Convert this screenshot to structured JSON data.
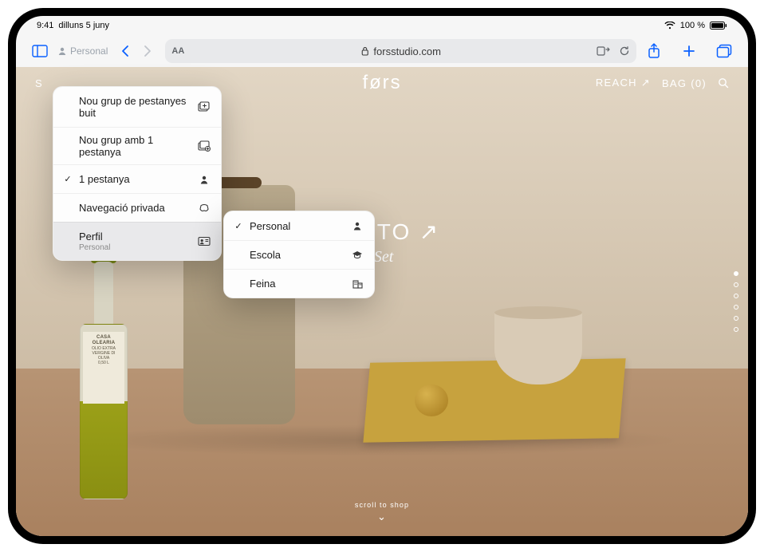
{
  "status": {
    "time": "9:41",
    "date": "dilluns 5 juny",
    "battery": "100 %"
  },
  "toolbar": {
    "profile_label": "Personal",
    "address": "forsstudio.com",
    "aa": "AA"
  },
  "site": {
    "shop": "S",
    "logo": "førs",
    "reach": "REACH",
    "bag": "BAG (0)",
    "hero_title": "RETTO",
    "hero_sub": "& Cup Set",
    "scroll_hint": "scroll to shop",
    "bottle_label_brand": "CASA OLEARIA",
    "bottle_label_text": "OLIO EXTRA VERGINE DI OLIVA",
    "bottle_label_size": "0,50 L"
  },
  "menu": {
    "new_empty": "Nou grup de pestanyes buit",
    "new_with_one": "Nou grup amb 1 pestanya",
    "one_tab": "1 pestanya",
    "private": "Navegació privada",
    "profile": "Perfil",
    "profile_sub": "Personal"
  },
  "profiles": {
    "personal": "Personal",
    "school": "Escola",
    "work": "Feina"
  }
}
